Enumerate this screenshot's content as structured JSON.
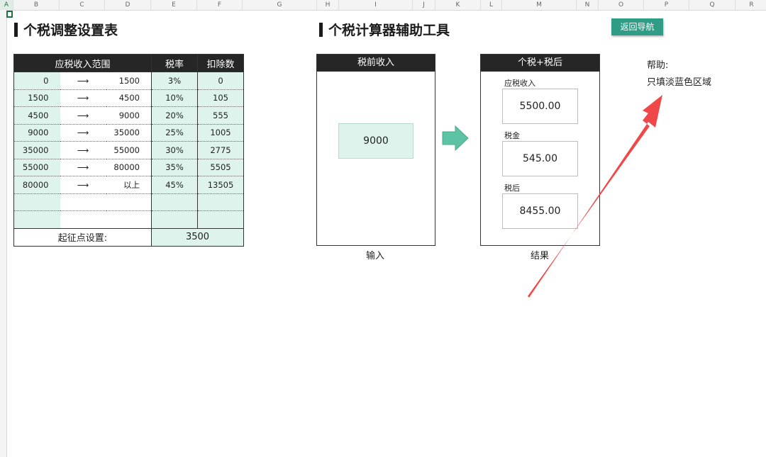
{
  "column_headers": [
    "A",
    "B",
    "C",
    "D",
    "E",
    "F",
    "G",
    "H",
    "I",
    "J",
    "K",
    "L",
    "M",
    "N",
    "O",
    "P",
    "Q",
    "R"
  ],
  "left_title": "个税调整设置表",
  "right_title": "个税计算器辅助工具",
  "nav_button": "返回导航",
  "tax_table": {
    "headers": {
      "range": "应税收入范围",
      "rate": "税率",
      "deduction": "扣除数"
    },
    "arrow": "⟶",
    "rows": [
      {
        "lo": "0",
        "hi": "1500",
        "rate": "3%",
        "ded": "0"
      },
      {
        "lo": "1500",
        "hi": "4500",
        "rate": "10%",
        "ded": "105"
      },
      {
        "lo": "4500",
        "hi": "9000",
        "rate": "20%",
        "ded": "555"
      },
      {
        "lo": "9000",
        "hi": "35000",
        "rate": "25%",
        "ded": "1005"
      },
      {
        "lo": "35000",
        "hi": "55000",
        "rate": "30%",
        "ded": "2775"
      },
      {
        "lo": "55000",
        "hi": "80000",
        "rate": "35%",
        "ded": "5505"
      },
      {
        "lo": "80000",
        "hi": "以上",
        "rate": "45%",
        "ded": "13505"
      }
    ],
    "threshold_label": "起征点设置:",
    "threshold_value": "3500"
  },
  "input_panel": {
    "header": "税前收入",
    "value": "9000",
    "caption": "输入"
  },
  "result_panel": {
    "header": "个税+税后",
    "caption": "结果",
    "items": [
      {
        "label": "应税收入",
        "value": "5500.00"
      },
      {
        "label": "税金",
        "value": "545.00"
      },
      {
        "label": "税后",
        "value": "8455.00"
      }
    ]
  },
  "help": {
    "title": "帮助:",
    "text": "只填淡蓝色区域"
  },
  "colors": {
    "header_bg": "#262626",
    "input_fill": "#ddf3ec",
    "accent_green": "#2f9c85",
    "arrow_red": "#f04848",
    "flow_arrow": "#5cc3a4"
  }
}
